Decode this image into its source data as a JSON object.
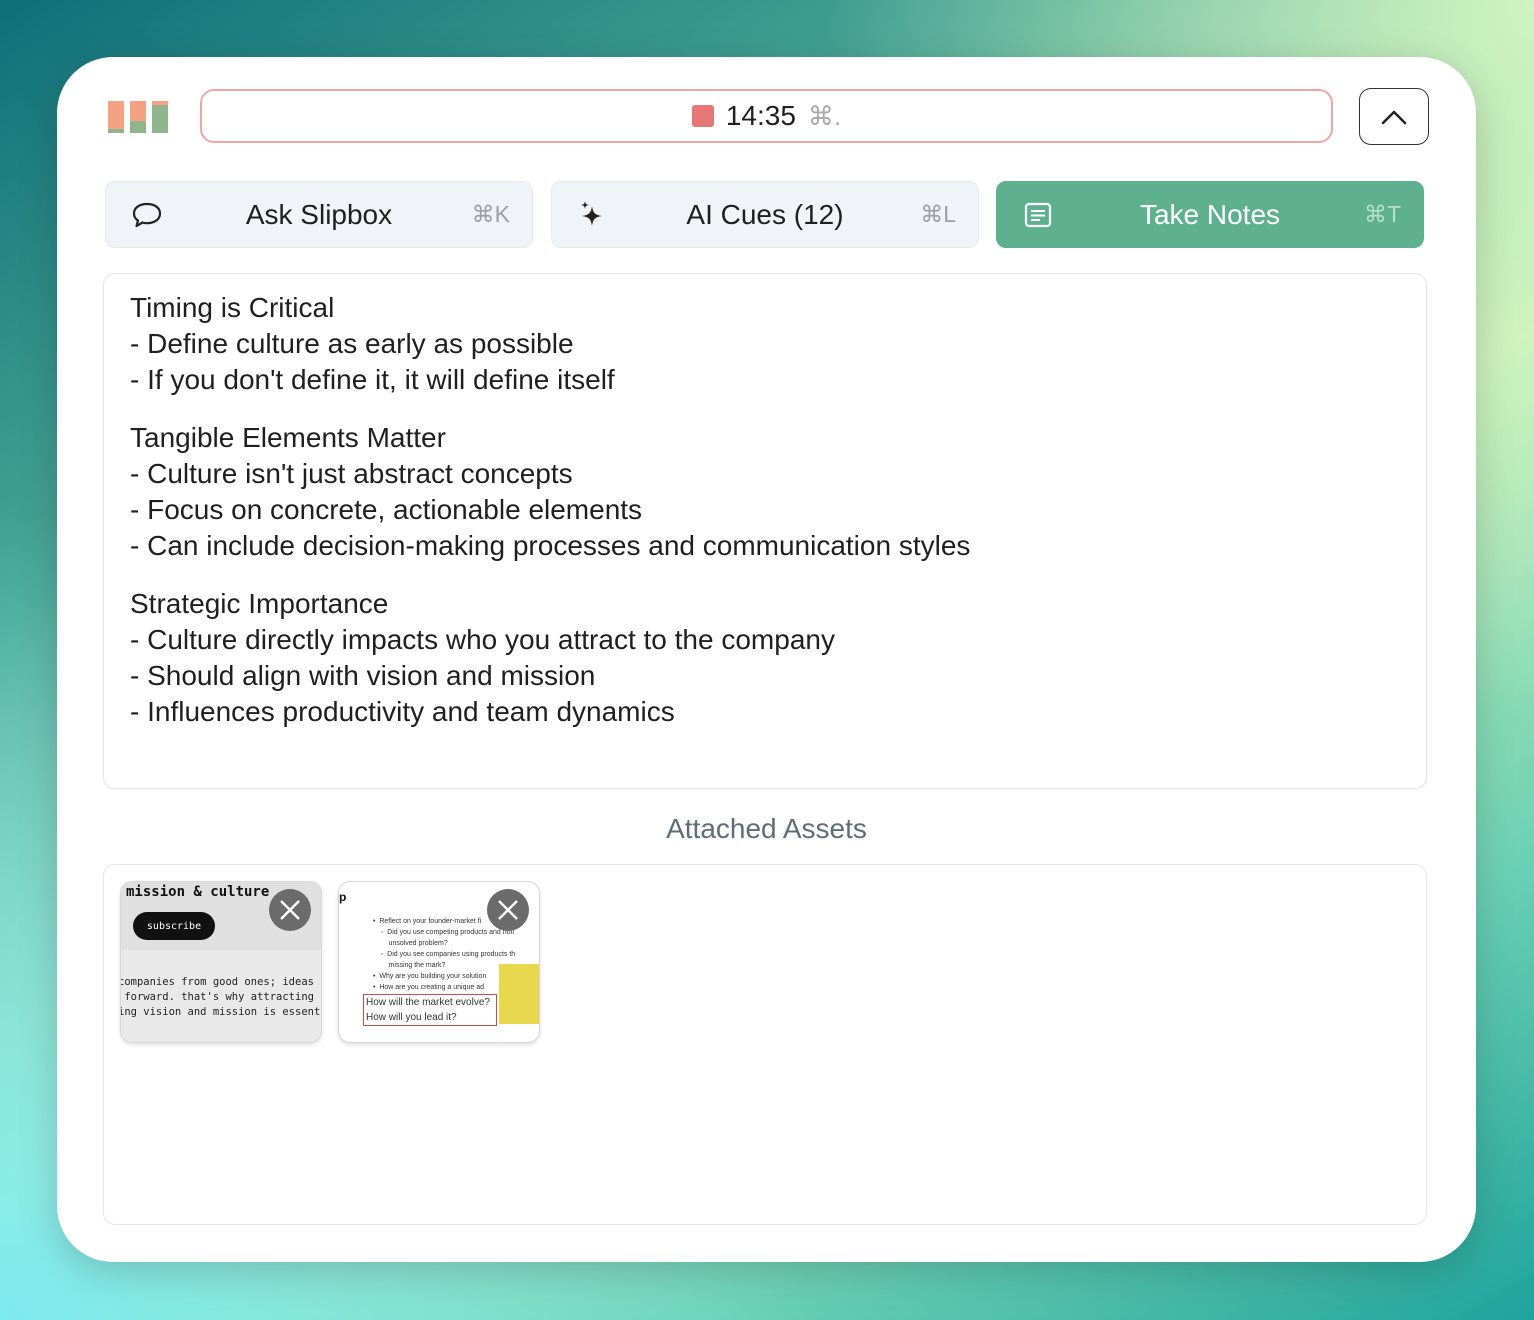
{
  "timer": {
    "time": "14:35",
    "shortcut": "⌘."
  },
  "tabs": [
    {
      "label": "Ask Slipbox",
      "shortcut": "⌘K",
      "icon": "chat-bubble-icon",
      "active": false
    },
    {
      "label": "AI Cues (12)",
      "shortcut": "⌘L",
      "icon": "sparkle-icon",
      "active": false
    },
    {
      "label": "Take Notes",
      "shortcut": "⌘T",
      "icon": "notes-icon",
      "active": true
    }
  ],
  "notes": {
    "lines": [
      "Timing is Critical",
      "- Define culture as early as possible",
      "- If you don't define it, it will define itself",
      "",
      "Tangible Elements Matter",
      "- Culture isn't just abstract concepts",
      "- Focus on concrete, actionable elements",
      "- Can include decision-making processes and communication styles",
      "",
      "Strategic Importance",
      "- Culture directly impacts who you attract to the company",
      "- Should align with vision and mission",
      "- Influences productivity and team dynamics"
    ]
  },
  "assets": {
    "title": "Attached Assets",
    "thumb1": {
      "heading": "mission & culture",
      "button": "subscribe",
      "body": "companies from good ones; ideas\n forward. that's why attracting\ning vision and mission is essent"
    },
    "thumb2": {
      "marker": "p",
      "body": "•  Reflect on your founder-market fi\n    ◦  Did you use competing products and noti\n        unsolved problem?\n    ◦  Did you see companies using products th\n        missing the mark?\n•  Why are you building your solution\n•  How are you creating a unique ad",
      "highlight_line1": "How will the market evolve?",
      "highlight_line2": "How will you lead it?"
    }
  },
  "colors": {
    "accent": "#5fb08f",
    "record": "#e57777",
    "logo_salmon": "#f4a184",
    "logo_green": "#8fb48e"
  }
}
